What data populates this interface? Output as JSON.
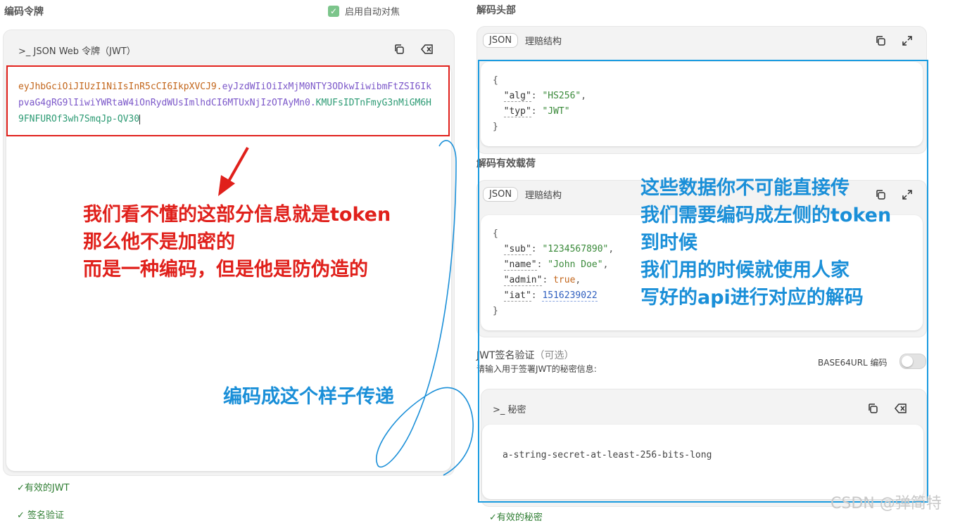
{
  "left": {
    "section_title": "编码令牌",
    "auto_focus_label": "启用自动对焦",
    "token_panel_title": ">_ JSON Web 令牌（JWT）",
    "token": {
      "header_part": "eyJhbGciOiJIUzI1NiIsInR5cCI6IkpXVCJ9",
      "dot1": ".",
      "payload_part": "eyJzdWIiOiIxMjM0NTY3ODkwIiwibmFtZSI6IkpvaG4gRG9lIiwiYWRtaW4iOnRydWUsImlhdCI6MTUxNjIzOTAyMn0",
      "dot2": ".",
      "signature_part": "KMUFsIDTnFmyG3nMiGM6H9FNFUROf3wh7SmqJp-QV30",
      "line1_a": "eyJhbGciOiJIUzI1NiIsInR5cCI6IkpXVCJ9.",
      "line1_b": "eyJzdWIiOiIxMjM0NTY3ODkwIiwibmFtZSI6Ik",
      "line2_a": "pvaG4gRG9lIiwiYWRtaW4iOnRydWUsImlhdCI6MTUxNjIzOTAyMn0.",
      "line2_b": "KMUFsIDTnFmyG3nMiGM6H",
      "line3": "9FNFUROf3wh7SmqJp-QV30"
    },
    "valid_jwt": "✓有效的JWT",
    "sig_verified": "✓ 签名验证"
  },
  "right": {
    "decoded_header_title": "解码头部",
    "decoded_payload_title": "解码有效载荷",
    "tab_json": "JSON",
    "tab_struct": "理赔结构",
    "header_json": {
      "open": "{",
      "alg_key": "\"alg\"",
      "alg_val": "\"HS256\"",
      "typ_key": "\"typ\"",
      "typ_val": "\"JWT\"",
      "close": "}"
    },
    "payload_json": {
      "open": "{",
      "sub_key": "\"sub\"",
      "sub_val": "\"1234567890\"",
      "name_key": "\"name\"",
      "name_val": "\"John Doe\"",
      "admin_key": "\"admin\"",
      "admin_val": "true",
      "iat_key": "\"iat\"",
      "iat_val": "1516239022",
      "close": "}"
    },
    "sig_title": "JWT签名验证",
    "sig_optional": "（可选）",
    "sig_desc": "请输入用于签署JWT的秘密信息:",
    "base64_label": "BASE64URL 编码",
    "base64_enabled": false,
    "secret_title": ">_ 秘密",
    "secret_value": "a-string-secret-at-least-256-bits-long",
    "valid_secret": "✓有效的秘密"
  },
  "annotations": {
    "red": [
      "我们看不懂的这部分信息就是token",
      "那么他不是加密的",
      "而是一种编码，但是他是防伪造的"
    ],
    "blue_bottom": "编码成这个样子传递",
    "blue_right": [
      "这些数据你不可能直接传",
      "我们需要编码成左侧的token",
      "到时候",
      "我们用的时候就使用人家",
      "写好的api进行对应的解码"
    ]
  },
  "watermark": "CSDN @弹简特",
  "colors": {
    "red_annotation": "#e0201b",
    "blue_annotation": "#1a8fd8",
    "token_header": "#c3661b",
    "token_payload": "#7b57c9",
    "token_signature": "#2b9a73",
    "check_green": "#7cc58b"
  }
}
